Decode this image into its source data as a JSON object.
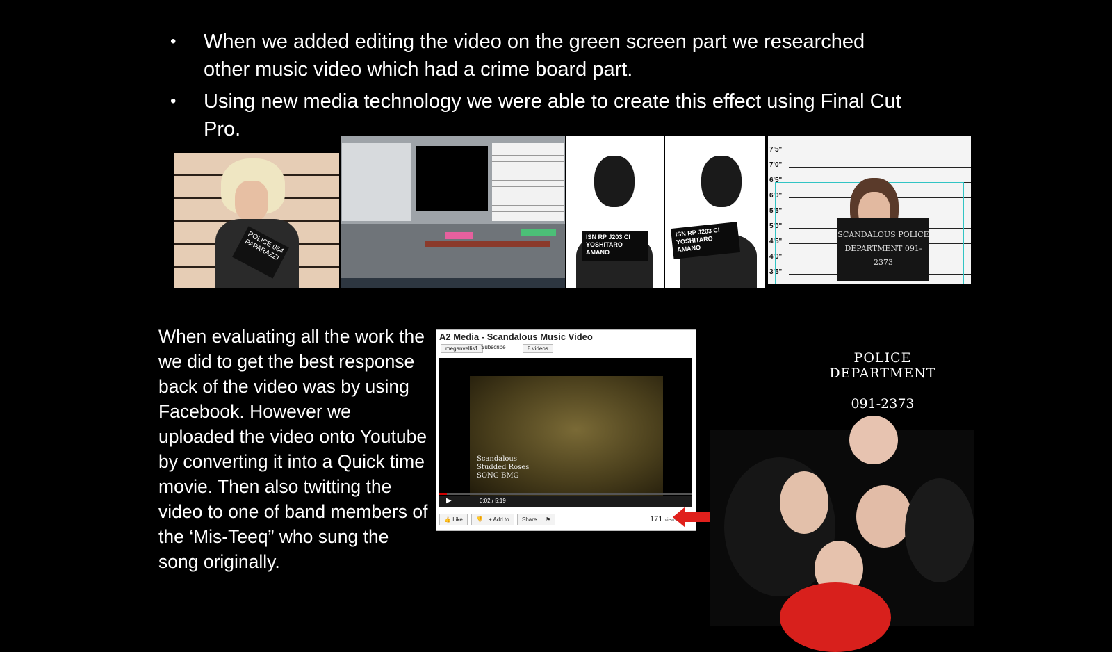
{
  "bullets": [
    "When we added editing the video on the green screen part we researched other music video which had a crime board part.",
    "Using new media technology we were able to create this effect using Final Cut Pro."
  ],
  "bullet_glyph": "•",
  "strip": {
    "gaga_sign": "POLICE 064 PAPARAZZI",
    "mugshot_plate_1": "ISN RP J203 CI YOSHITARO AMANO",
    "mugshot_plate_2": "ISN RP J203 CI YOSHITARO AMANO",
    "lineup_marks": [
      "7'5\"",
      "7'0\"",
      "6'5\"",
      "6'0\"",
      "5'5\"",
      "5'0\"",
      "4'5\"",
      "4'0\"",
      "3'5\""
    ],
    "lineup_board": "SCANDALOUS POLICE DEPARTMENT 091-2373"
  },
  "evaluation_text": "When evaluating all the work the we did to get the best response back of the video was by using Facebook. However we uploaded the video onto Youtube by converting it into a Quick time movie. Then also twitting the video to one of band members of the ‘Mis-Teeq” who sung the song originally.",
  "youtube": {
    "title": "A2 Media - Scandalous Music Video",
    "channel": "meganvellis1",
    "subscribe": "Subscribe",
    "videos": "8 videos",
    "caption_lines": [
      "Scandalous",
      "Studded Roses",
      "SONG BMG"
    ],
    "time": "0:02 / 5:19",
    "progress": 0.03,
    "like": "Like",
    "add_to": "+ Add to",
    "share": "Share",
    "views_count": "171",
    "views_label": "views"
  },
  "police": {
    "line1": "POLICE DEPARTMENT",
    "line2": "091-2373"
  },
  "colors": {
    "background": "#000000",
    "arrow": "#e0201c",
    "lineup_guide": "#31c4c4"
  }
}
